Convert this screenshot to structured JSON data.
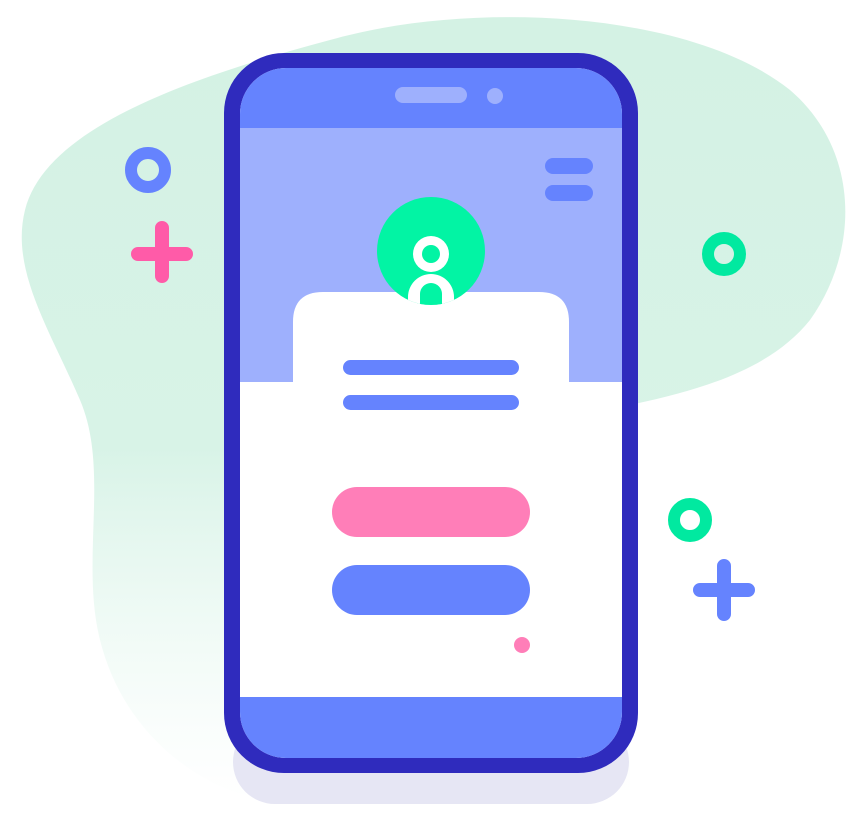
{
  "illustration": {
    "subject": "mobile-login-illustration",
    "icons": {
      "avatar": "user-avatar-icon",
      "menu": "hamburger-menu-icon",
      "decor_ring": "ring-icon",
      "decor_sparkle": "sparkle-icon"
    }
  },
  "colors": {
    "background_blob": "#d4f2e4",
    "phone_frame": "#2f2bbd",
    "phone_bar": "#6583fe",
    "screen_header": "#9eb0fd",
    "screen_body": "#ffffff",
    "text_line": "#6583fe",
    "primary_button": "#ff7eb8",
    "secondary_button": "#6583fe",
    "avatar": "#02f4a4",
    "accent_pink": "#ff5ba8",
    "accent_green": "#01e9a0",
    "accent_blue": "#6583fe",
    "shadow": "#e6e6f4"
  }
}
